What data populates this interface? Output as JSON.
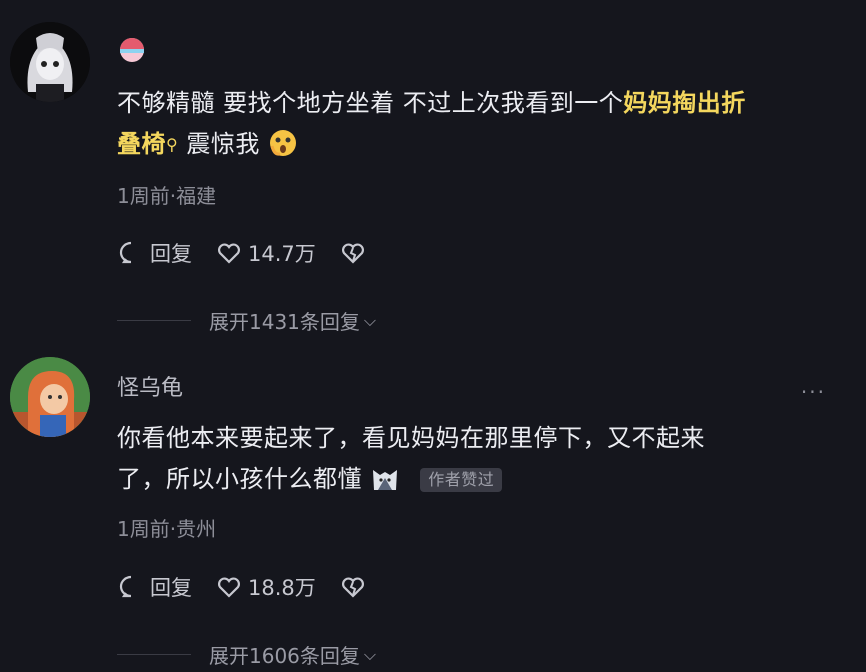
{
  "comments": [
    {
      "username": "",
      "text_plain": "不够精髓 要找个地方坐着 不过上次我看到一个",
      "text_highlight_1": "妈妈掏出折",
      "text_highlight_2": "叠椅",
      "text_tail": "震惊我",
      "meta": "1周前·福建",
      "reply_label": "回复",
      "likes": "14.7万",
      "expand_label": "展开1431条回复"
    },
    {
      "username": "怪乌龟",
      "text_line1": "你看他本来要起来了，看见妈妈在那里停下，又不起来",
      "text_line2": "了，所以小孩什么都懂",
      "author_tag": "作者赞过",
      "meta": "1周前·贵州",
      "reply_label": "回复",
      "likes": "18.8万",
      "more": "···",
      "expand_label": "展开1606条回复"
    }
  ],
  "colors": {
    "background": "#15161d",
    "highlight": "#f4d75e"
  }
}
